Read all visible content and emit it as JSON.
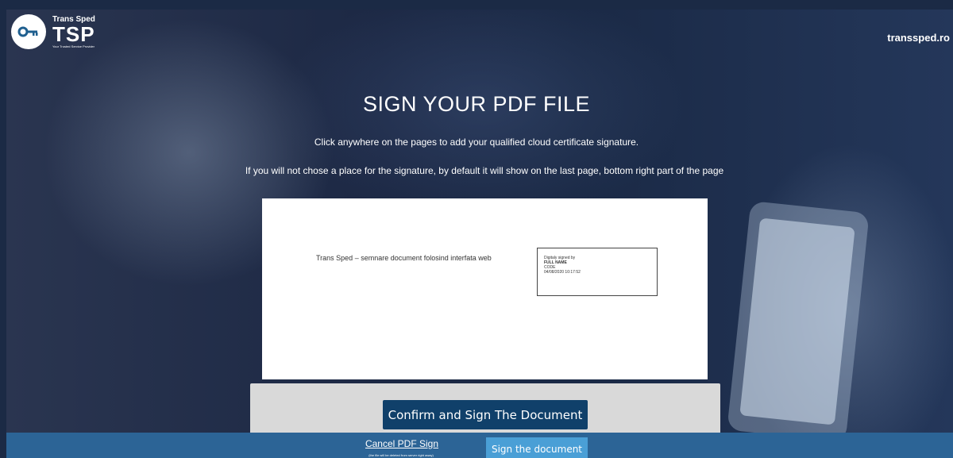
{
  "header": {
    "logo_small": "Trans Sped",
    "logo_big": "TSP",
    "logo_tagline": "Your Trusted Service Provider",
    "site_link": "transsped.ro"
  },
  "main": {
    "title": "SIGN YOUR PDF FILE",
    "subtitle": "Click anywhere on the pages to add your qualified cloud certificate signature.",
    "info": "If you will not chose a place for the signature, by default it will show on the last page, bottom right part of the page"
  },
  "pdf": {
    "document_text": "Trans Sped – semnare document folosind interfata web",
    "signature": {
      "line1": "Digitaly signed by",
      "line2": "FULL NAME",
      "line3": "CODE",
      "line4": "04/08/2020 10:17:52"
    }
  },
  "actions": {
    "confirm_label": "Confirm and Sign The Document",
    "cancel_label": "Cancel PDF Sign",
    "cancel_note": "(the file will be deleted from server right away)",
    "sign_label": "Sign the document"
  },
  "colors": {
    "confirm_button": "#10406a",
    "bottom_bar": "#2c6496",
    "sign_button": "#4a9fd6",
    "action_panel": "#d9d9d9"
  },
  "icons": {
    "logo": "key-icon"
  }
}
